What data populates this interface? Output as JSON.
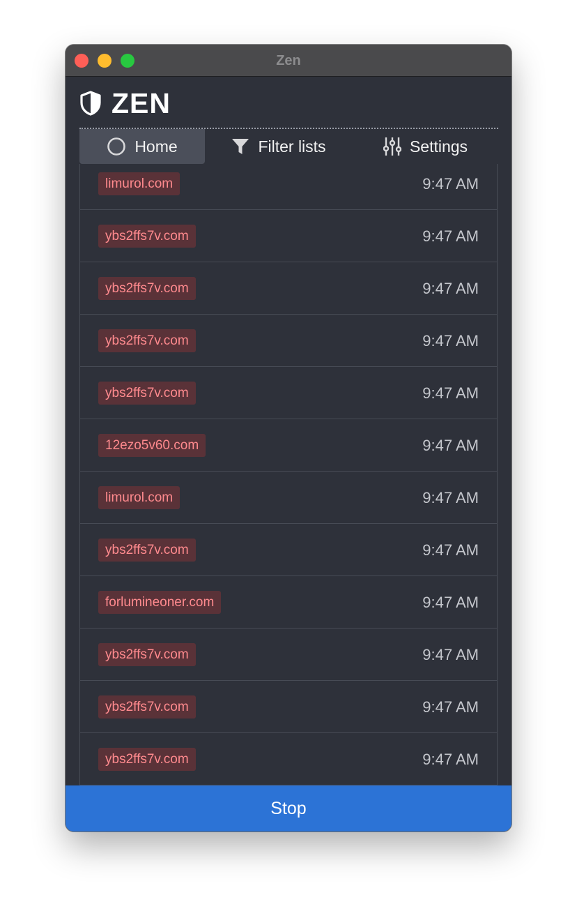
{
  "window": {
    "title": "Zen"
  },
  "brand": {
    "name": "ZEN",
    "icon": "shield-icon"
  },
  "tabs": [
    {
      "label": "Home",
      "icon": "circle-icon",
      "active": true
    },
    {
      "label": "Filter lists",
      "icon": "filter-icon",
      "active": false
    },
    {
      "label": "Settings",
      "icon": "sliders-icon",
      "active": false
    }
  ],
  "requests": [
    {
      "domain": "limurol.com",
      "time": "9:47 AM"
    },
    {
      "domain": "ybs2ffs7v.com",
      "time": "9:47 AM"
    },
    {
      "domain": "ybs2ffs7v.com",
      "time": "9:47 AM"
    },
    {
      "domain": "ybs2ffs7v.com",
      "time": "9:47 AM"
    },
    {
      "domain": "ybs2ffs7v.com",
      "time": "9:47 AM"
    },
    {
      "domain": "12ezo5v60.com",
      "time": "9:47 AM"
    },
    {
      "domain": "limurol.com",
      "time": "9:47 AM"
    },
    {
      "domain": "ybs2ffs7v.com",
      "time": "9:47 AM"
    },
    {
      "domain": "forlumineoner.com",
      "time": "9:47 AM"
    },
    {
      "domain": "ybs2ffs7v.com",
      "time": "9:47 AM"
    },
    {
      "domain": "ybs2ffs7v.com",
      "time": "9:47 AM"
    },
    {
      "domain": "ybs2ffs7v.com",
      "time": "9:47 AM"
    }
  ],
  "stop_button": {
    "label": "Stop"
  },
  "colors": {
    "accent": "#2c73d6",
    "blocked_badge_bg": "#5a3238",
    "blocked_badge_text": "#ff8a8e",
    "window_bg": "#2e313a"
  }
}
